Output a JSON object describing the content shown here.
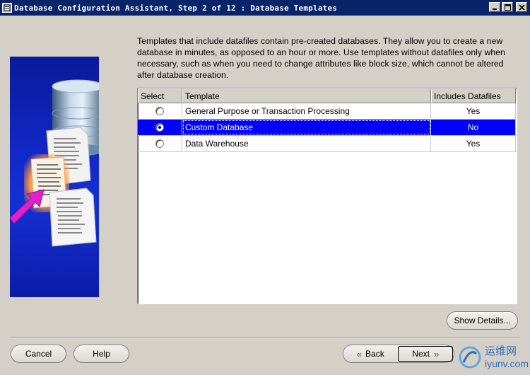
{
  "window": {
    "title": "Database Configuration Assistant, Step 2 of 12 : Database Templates",
    "minimize_label": "_",
    "maximize_label": "□",
    "close_label": "×"
  },
  "description": "Templates that include datafiles contain pre-created databases. They allow you to create a new database in minutes, as opposed to an hour or more. Use templates without datafiles only when necessary, such as when you need to change attributes like block size, which cannot be altered after database creation.",
  "table": {
    "headers": {
      "select": "Select",
      "template": "Template",
      "includes_datafiles": "Includes Datafiles"
    },
    "rows": [
      {
        "template": "General Purpose or Transaction Processing",
        "includes_datafiles": "Yes",
        "selected": false
      },
      {
        "template": "Custom Database",
        "includes_datafiles": "No",
        "selected": true
      },
      {
        "template": "Data Warehouse",
        "includes_datafiles": "Yes",
        "selected": false
      }
    ]
  },
  "buttons": {
    "show_details": "Show Details...",
    "cancel": "Cancel",
    "help": "Help",
    "back": "Back",
    "next": "Next"
  },
  "watermark": {
    "cn": "运维网",
    "en": "iyunv.com"
  },
  "colors": {
    "titlebar": "#0a246a",
    "selection": "#0000ff",
    "illustration_bg": "#1228c8",
    "arrow": "#e020c8"
  },
  "icons": {
    "back_chevron": "«",
    "next_chevron": "»"
  }
}
